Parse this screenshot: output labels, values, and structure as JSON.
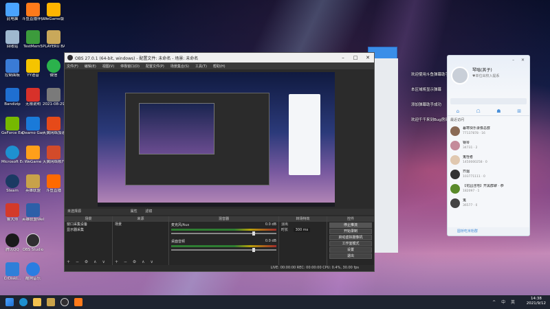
{
  "desktop": {
    "icons": [
      {
        "label": "此电脑",
        "color": "#4aa3ff"
      },
      {
        "label": "斗鱼直播伴侣",
        "color": "#ff7a1a"
      },
      {
        "label": "WeGame版",
        "color": "#ffb400"
      },
      {
        "label": "回收站",
        "color": "#9fb8cf"
      },
      {
        "label": "TestMem5",
        "color": "#3c9b3c"
      },
      {
        "label": "PLAYERU BATTLEGR...",
        "color": "#c9a85a"
      },
      {
        "label": "控制面板",
        "color": "#3a7bd5"
      },
      {
        "label": "YY语音",
        "color": "#f5c400"
      },
      {
        "label": "微信",
        "color": "#2bb24c"
      },
      {
        "label": "Bandizip",
        "color": "#1f6fd1"
      },
      {
        "label": "无限说明",
        "color": "#d8312a"
      },
      {
        "label": "2021-08-29 21-17-59_...",
        "color": "#7a7a7a"
      },
      {
        "label": "GeForce Experience",
        "color": "#76b900"
      },
      {
        "label": "Deamo Gamin...",
        "color": "#1a7ad9"
      },
      {
        "label": "天翼网络加速工具",
        "color": "#e64a19"
      },
      {
        "label": "Microsoft Edge",
        "color": "#1e90d0"
      },
      {
        "label": "WeGame",
        "color": "#ff9f1a"
      },
      {
        "label": "天翼网络账户",
        "color": "#d34b2a"
      },
      {
        "label": "Steam",
        "color": "#1b3a63"
      },
      {
        "label": "英雄联盟",
        "color": "#c8a24a"
      },
      {
        "label": "斗鱼直播",
        "color": "#ff6a00"
      },
      {
        "label": "鲁大师",
        "color": "#d33a2a"
      },
      {
        "label": "英雄联盟WeGame版",
        "color": "#2d5fa8"
      },
      {
        "label": "腾讯QQ",
        "color": "#1a1a1a"
      },
      {
        "label": "OBS Studio",
        "color": "#302e31"
      },
      {
        "label": "CrDiskI...",
        "color": "#2f7fd8"
      },
      {
        "label": "酷狗音乐",
        "color": "#2a7de1"
      }
    ]
  },
  "obs": {
    "title": "OBS 27.0.1 (64-bit, windows) - 配置文件: 未命名 - 场景: 未命名",
    "menu": [
      "文件(F)",
      "编辑(E)",
      "视图(V)",
      "停靠窗口(D)",
      "配置文件(P)",
      "场景集合(S)",
      "工具(T)",
      "帮助(H)"
    ],
    "panel_header": "未选择源",
    "panel_header_buttons": [
      "属性",
      "滤镜"
    ],
    "docks": {
      "scenes": {
        "title": "场景",
        "items": [
          "窗口采集设备",
          "显示器采集"
        ]
      },
      "sources": {
        "title": "来源",
        "items": [
          "场景"
        ]
      },
      "mixer": {
        "title": "混音器",
        "channels": [
          {
            "name": "麦克风/Aux",
            "db": "0.0 dB"
          },
          {
            "name": "桌面音频",
            "db": "0.0 dB"
          }
        ]
      },
      "transitions": {
        "title": "转场特效",
        "type": "淡出",
        "duration_label": "时长",
        "duration": "300 ms"
      },
      "controls": {
        "title": "控件",
        "buttons": [
          "停止推流",
          "开始录制",
          "启动虚拟摄像机",
          "工作室模式",
          "设置",
          "退出"
        ]
      }
    },
    "status": "LIVE: 00:00:00   REC: 00:00:00   CPU: 0.4%, 30.00 fps"
  },
  "side_messages": [
    "欢迎使用斗鱼弹幕助手",
    "本区域将显示弹幕",
    "添加弹幕助手成功",
    "欢迎千千来到Bug房间"
  ],
  "qq": {
    "name": "琴嗡(其子)",
    "signature": "♥单位出校入提系",
    "section": "最近访问",
    "contacts": [
      {
        "name": "暮寒快乐录像总群",
        "meta": "77137878  ·  16"
      },
      {
        "name": "钢琴",
        "meta": "34731  ·  2"
      },
      {
        "name": "鬼怪者",
        "meta": "1450000258  ·  0"
      },
      {
        "name": "芥烟",
        "meta": "103771111  ·  0"
      },
      {
        "name": "【花园洼地】开黑群聊 · 恭",
        "meta": "182097  ·  1"
      },
      {
        "name": "鬼",
        "meta": "36577  ·  0"
      }
    ],
    "bottom_label": "圆桥吃米粉群"
  },
  "taskbar": {
    "time": "14:38",
    "date": "2021/9/12",
    "tray": "^ 中 英"
  }
}
